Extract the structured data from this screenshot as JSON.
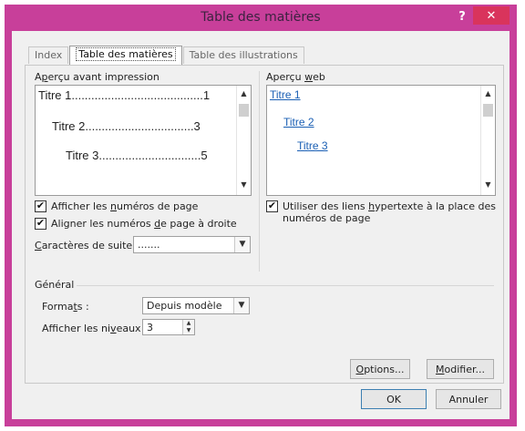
{
  "window": {
    "title": "Table des matières",
    "help_glyph": "?",
    "close_glyph": "✕"
  },
  "tabs": [
    {
      "label": "Index"
    },
    {
      "label": "Table des matières"
    },
    {
      "label": "Table des illustrations"
    }
  ],
  "print_preview": {
    "label_prefix": "A",
    "label_u": "p",
    "label_rest": "erçu avant impression",
    "lines": [
      {
        "text": "Titre 1........................................1"
      },
      {
        "text": "Titre 2.................................3"
      },
      {
        "text": "Titre 3...............................5"
      }
    ]
  },
  "web_preview": {
    "label_prefix": "Aperçu ",
    "label_u": "w",
    "label_rest": "eb",
    "links": [
      "Titre 1",
      "Titre 2",
      "Titre 3"
    ]
  },
  "options": {
    "show_page_numbers": {
      "checked": true,
      "pre": "Afficher les ",
      "u": "n",
      "post": "uméros de page"
    },
    "align_right": {
      "checked": true,
      "pre": "Aligner les numéros ",
      "u": "d",
      "post": "e page à droite"
    },
    "hyperlinks": {
      "checked": true,
      "pre": "Utiliser des liens ",
      "u": "h",
      "post": "ypertexte à la place des",
      "line2": "numéros de page"
    },
    "leader": {
      "u": "C",
      "label_rest": "aractères de suite :",
      "value": "......."
    }
  },
  "general": {
    "title": "Général",
    "formats": {
      "pre": "Forma",
      "u": "t",
      "post": "s :",
      "value": "Depuis modèle"
    },
    "levels": {
      "pre": "Afficher les ni",
      "u": "v",
      "post": "eaux :",
      "value": "3"
    }
  },
  "buttons": {
    "options": {
      "u": "O",
      "rest": "ptions..."
    },
    "modify": {
      "u": "M",
      "rest": "odifier..."
    },
    "ok": "OK",
    "cancel": "Annuler"
  },
  "colors": {
    "frame": "#c83f9a",
    "close": "#d9345c",
    "link": "#1a5fb4"
  }
}
